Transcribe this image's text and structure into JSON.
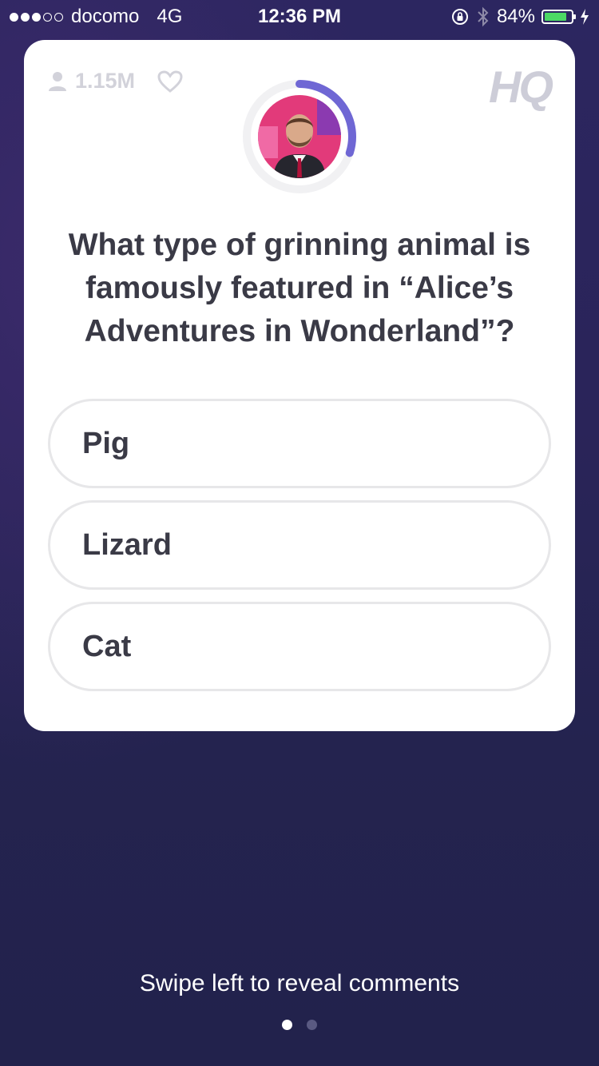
{
  "status_bar": {
    "carrier": "docomo",
    "network": "4G",
    "time": "12:36 PM",
    "battery_percent": "84%",
    "battery_level": 0.84,
    "signal_bars_filled": 3,
    "signal_bars_total": 5,
    "icons": [
      "orientation-lock-icon",
      "bluetooth-icon",
      "battery-icon",
      "charging-bolt-icon"
    ]
  },
  "card": {
    "viewer_count": "1.15M",
    "logo": "HQ",
    "icons": [
      "person-icon",
      "heart-icon"
    ],
    "timer_progress": 0.3,
    "host_avatar_label": "host",
    "question": "What type of grinning animal is famously featured in “Alice’s Adventures in Wonderland”?",
    "answers": [
      {
        "label": "Pig"
      },
      {
        "label": "Lizard"
      },
      {
        "label": "Cat"
      }
    ]
  },
  "footer": {
    "hint": "Swipe left to reveal comments",
    "page_index": 0,
    "page_count": 2
  },
  "colors": {
    "background_top": "#2c2660",
    "background_bottom": "#22224c",
    "timer_arc": "#6f67d4",
    "battery_fill": "#4cd964",
    "text_dark": "#3a3a46"
  }
}
